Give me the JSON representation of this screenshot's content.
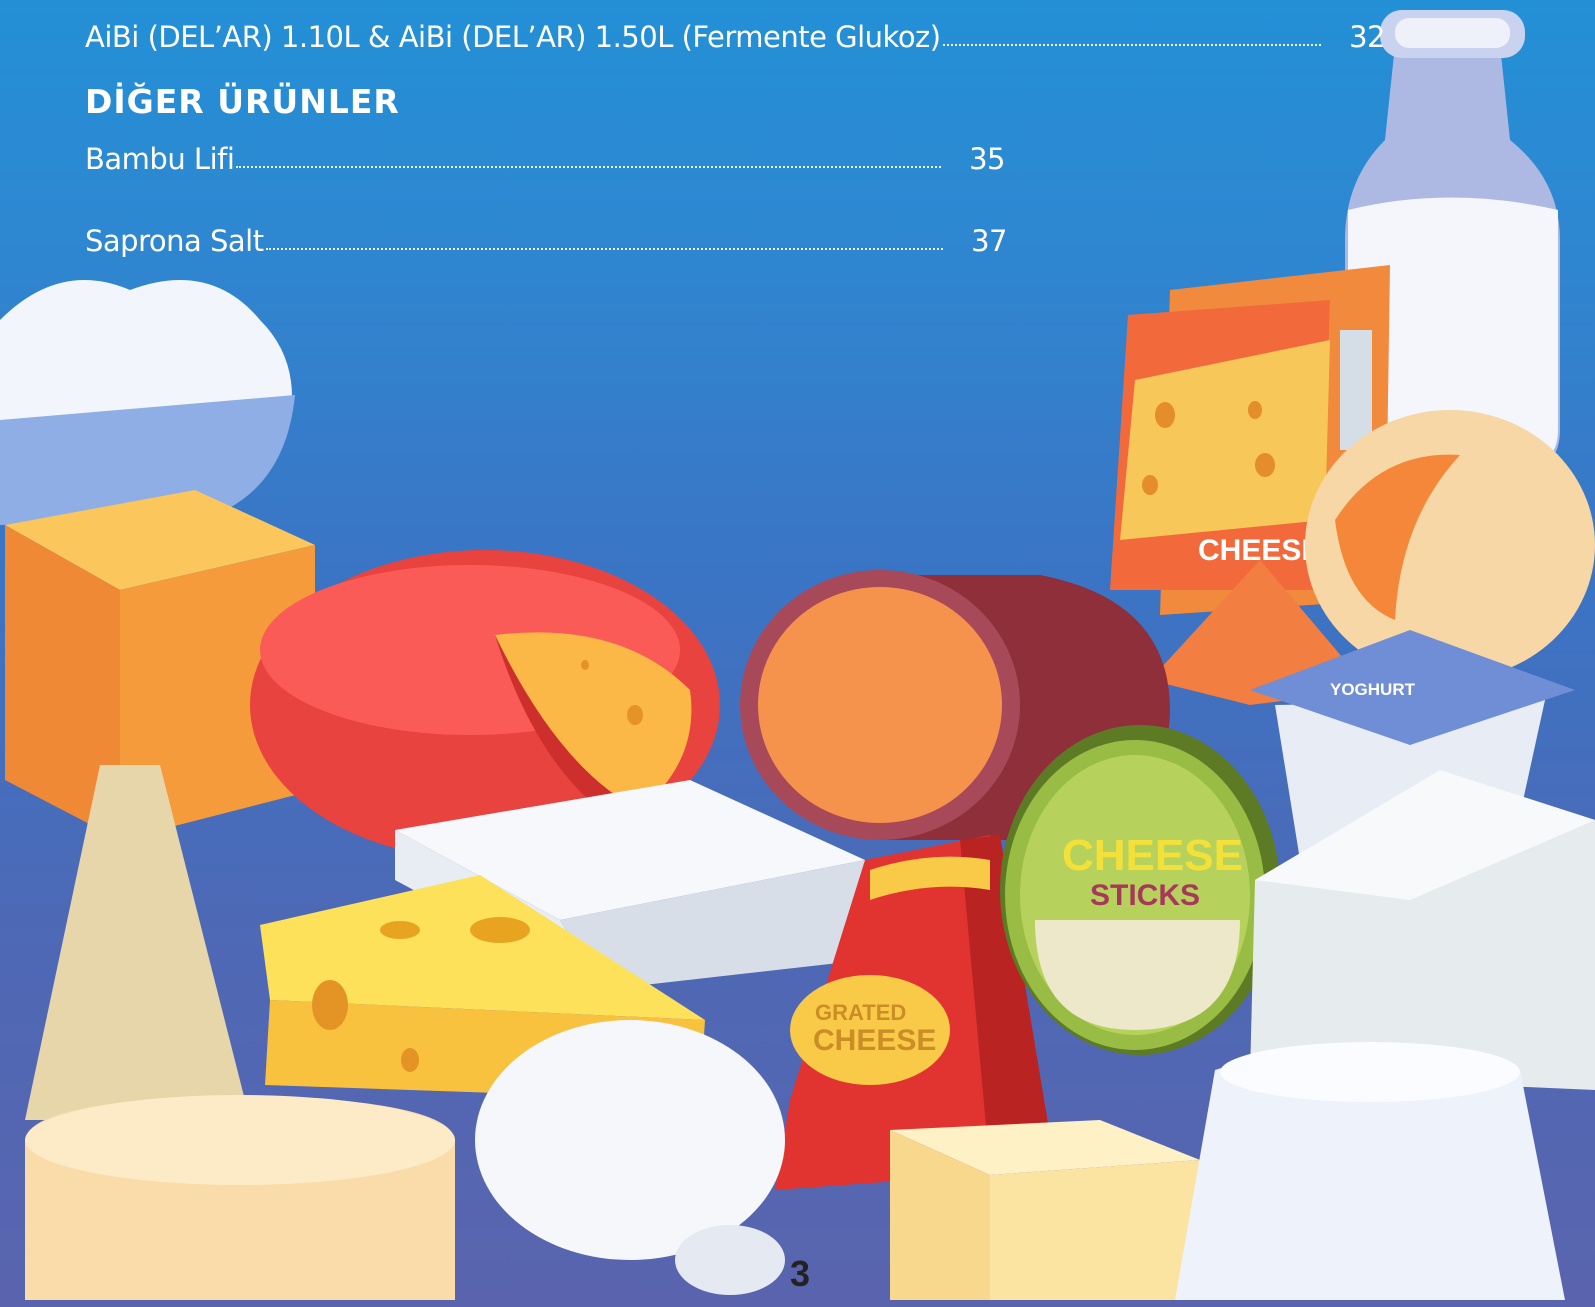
{
  "toc": {
    "top_entry": {
      "title": "AiBi (DEL’AR) 1.10L & AiBi (DEL’AR) 1.50L (Fermente Glukoz)",
      "page": "32"
    },
    "section_heading": "DİĞER ÜRÜNLER",
    "entries": [
      {
        "title": "Bambu Lifi",
        "page": "35"
      },
      {
        "title": "Saprona Salt",
        "page": "37"
      }
    ]
  },
  "illustration": {
    "labels": {
      "cheese_slices": "CHEESE SL",
      "yoghurt": "YOGHURT",
      "cheese_sticks_line1": "CHEESE",
      "cheese_sticks_line2": "STICKS",
      "grated_line1": "GRATED",
      "grated_line2": "CHEESE"
    },
    "icons": [
      "milk-bottle-icon",
      "cheese-wheel-icon",
      "cheese-block-icon",
      "yoghurt-cup-icon",
      "mozzarella-icon",
      "cottage-cheese-icon"
    ]
  },
  "footer": {
    "page_number": "3"
  }
}
